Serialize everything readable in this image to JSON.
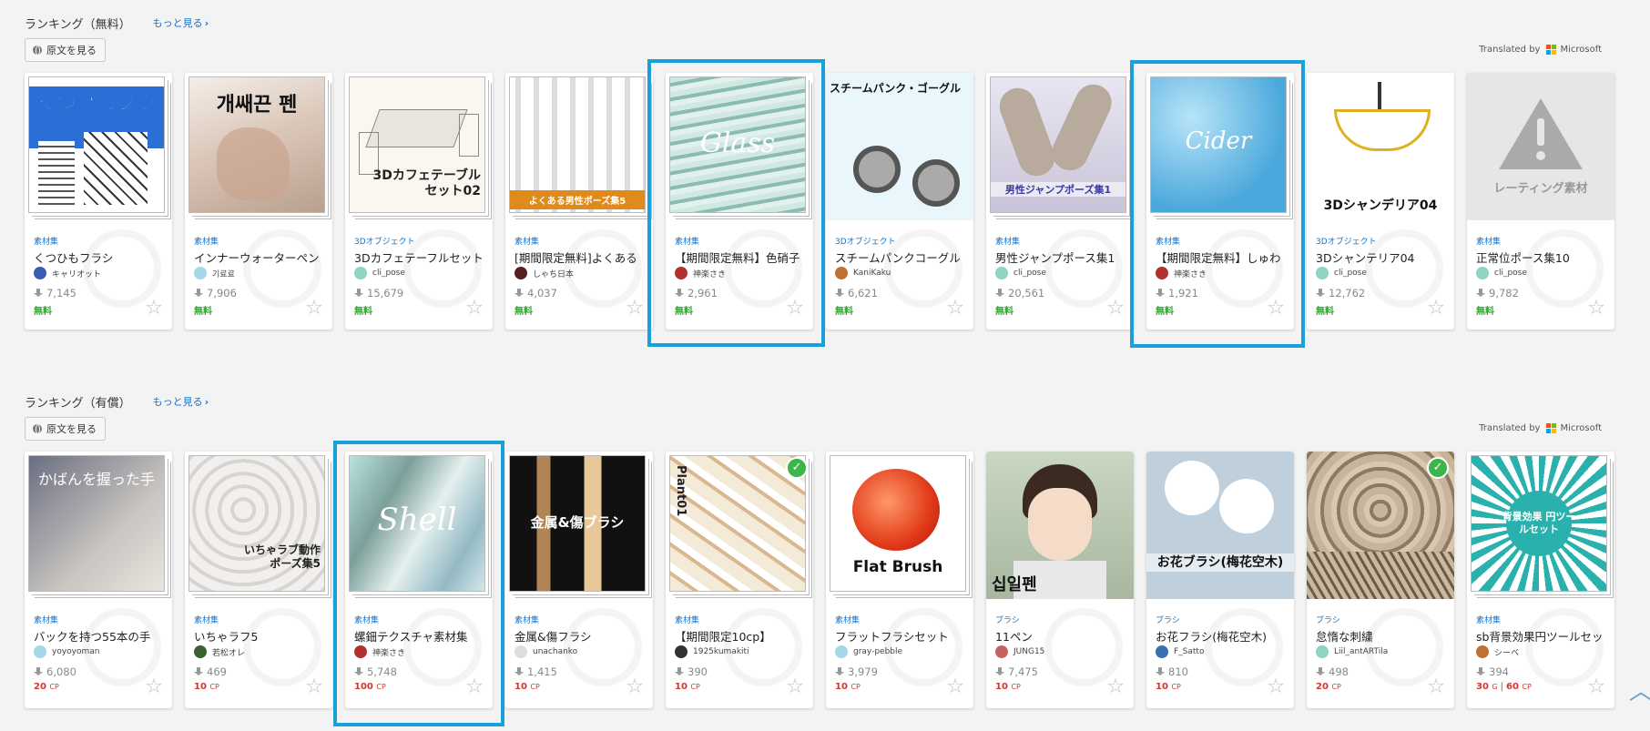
{
  "free_section": {
    "title": "ランキング（無料）",
    "more": "もっと見る",
    "original_button": "原文を見る",
    "translated_by": "Translated by",
    "translator": "Microsoft",
    "items": [
      {
        "thumb_text": "くつひもブラシ",
        "category": "素材集",
        "title": "くつひもフラシ",
        "author": "キャリオット",
        "downloads": "7,145",
        "price": "無料",
        "avatar_color": "#3b5bb5"
      },
      {
        "thumb_text": "개쌔끈 펜",
        "category": "素材集",
        "title": "インナーウォーターペン",
        "author": "기료료",
        "downloads": "7,906",
        "price": "無料",
        "avatar_color": "#a6d7e6"
      },
      {
        "thumb_text": "3Dカフェテーブルセット02",
        "category": "3Dオブジェクト",
        "title": "3Dカフェテーフルセット",
        "author": "cli_pose",
        "downloads": "15,679",
        "price": "無料",
        "avatar_color": "#8fd3c2"
      },
      {
        "thumb_text": "よくある男性ポーズ集5",
        "category": "素材集",
        "title": "[期間限定無料]よくある",
        "author": "しゃち日本",
        "downloads": "4,037",
        "price": "無料",
        "avatar_color": "#5a2020"
      },
      {
        "thumb_text": "Glass",
        "category": "素材集",
        "title": "【期間限定無料】色硝子",
        "author": "神楽さき",
        "downloads": "2,961",
        "price": "無料",
        "avatar_color": "#b23030"
      },
      {
        "thumb_text": "スチームパンク・ゴーグル",
        "category": "3Dオブジェクト",
        "title": "スチームパンクコーグル",
        "author": "KaniKaku",
        "downloads": "6,621",
        "price": "無料",
        "avatar_color": "#c07030"
      },
      {
        "thumb_text": "男性ジャンプポーズ集1",
        "category": "素材集",
        "title": "男性ジャンプポース集1",
        "author": "cli_pose",
        "downloads": "20,561",
        "price": "無料",
        "avatar_color": "#8fd3c2"
      },
      {
        "thumb_text": "Cider",
        "category": "素材集",
        "title": "【期間限定無料】しゅわ",
        "author": "神楽さき",
        "downloads": "1,921",
        "price": "無料",
        "avatar_color": "#b23030"
      },
      {
        "thumb_text": "3Dシャンデリア04",
        "category": "3Dオブジェクト",
        "title": "3Dシャンテリア04",
        "author": "cli_pose",
        "downloads": "12,762",
        "price": "無料",
        "avatar_color": "#8fd3c2"
      },
      {
        "thumb_text": "レーティング素材",
        "category": "素材集",
        "title": "正常位ポース集10",
        "author": "cli_pose",
        "downloads": "9,782",
        "price": "無料",
        "avatar_color": "#8fd3c2"
      }
    ]
  },
  "paid_section": {
    "title": "ランキング（有償）",
    "more": "もっと見る",
    "original_button": "原文を見る",
    "translated_by": "Translated by",
    "translator": "Microsoft",
    "items": [
      {
        "thumb_text": "かばんを握った手",
        "category": "素材集",
        "title": "バックを持つ55本の手",
        "author": "yoyoyoman",
        "downloads": "6,080",
        "price": "20",
        "unit": "CP",
        "avatar_color": "#a6d7e6"
      },
      {
        "thumb_text": "いちゃラブ動作ポーズ集5",
        "category": "素材集",
        "title": "いちゃラフ5",
        "author": "若松オレ",
        "downloads": "469",
        "price": "10",
        "unit": "CP",
        "avatar_color": "#3c6030"
      },
      {
        "thumb_text": "Shell",
        "category": "素材集",
        "title": "螺鈿テクスチャ素材集",
        "author": "神楽さき",
        "downloads": "5,748",
        "price": "100",
        "unit": "CP",
        "avatar_color": "#b23030"
      },
      {
        "thumb_text": "金属&傷ブラシ",
        "category": "素材集",
        "title": "金属&傷フラシ",
        "author": "unachanko",
        "downloads": "1,415",
        "price": "10",
        "unit": "CP",
        "avatar_color": "#dddddd"
      },
      {
        "thumb_text": "Plant01",
        "category": "素材集",
        "title": "【期間限定10cp】",
        "author": "1925kumakiti",
        "downloads": "390",
        "price": "10",
        "unit": "CP",
        "avatar_color": "#333333"
      },
      {
        "thumb_text": "Flat Brush",
        "category": "素材集",
        "title": "フラットフラシセット",
        "author": "gray-pebble",
        "downloads": "3,979",
        "price": "10",
        "unit": "CP",
        "avatar_color": "#a6d7e6"
      },
      {
        "thumb_text": "십일펜",
        "category": "ブラシ",
        "title": "11ペン",
        "author": "JUNG15",
        "downloads": "7,475",
        "price": "10",
        "unit": "CP",
        "avatar_color": "#c86060"
      },
      {
        "thumb_text": "お花ブラシ(梅花空木)",
        "category": "ブラシ",
        "title": "お花フラシ(梅花空木)",
        "author": "F_Satto",
        "downloads": "810",
        "price": "10",
        "unit": "CP",
        "avatar_color": "#3a70b0"
      },
      {
        "thumb_text": "",
        "category": "ブラシ",
        "title": "怠惰な刺繍",
        "author": "Liil_antARTila",
        "downloads": "498",
        "price": "20",
        "unit": "CP",
        "avatar_color": "#8fd3c2"
      },
      {
        "thumb_text": "背景効果 円ツールセット",
        "category": "素材集",
        "title": "sb背景効果円ツールセッ",
        "author": "シーベ",
        "downloads": "394",
        "price": "30",
        "unit": "G",
        "price2": "60",
        "unit2": "CP",
        "avatar_color": "#c07030"
      }
    ]
  },
  "colors": {
    "accent": "#1a73c7",
    "free": "#2ba52e",
    "paid": "#d0382f",
    "highlight": "#1aa0d8"
  },
  "icons": {
    "download": "download-icon",
    "favorite": "star-outline-icon",
    "globe": "globe-icon",
    "scroll_top": "chevron-up-icon"
  }
}
